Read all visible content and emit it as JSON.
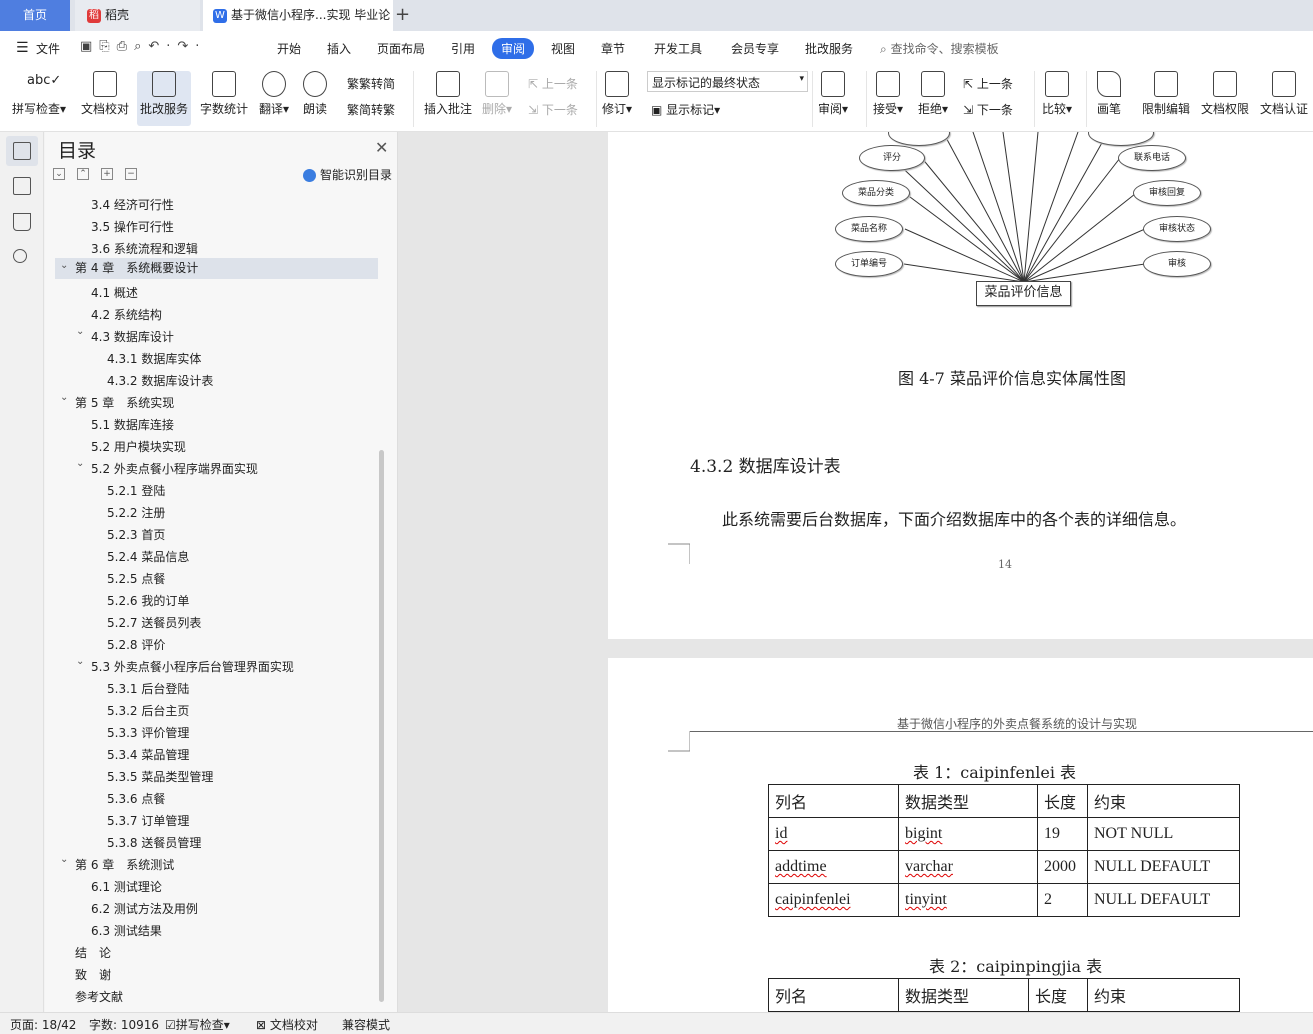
{
  "tabs": {
    "home": "首页",
    "daoke": "稻壳",
    "doc": "基于微信小程序...实现 毕业论"
  },
  "menu": [
    "文件",
    "开始",
    "插入",
    "页面布局",
    "引用",
    "审阅",
    "视图",
    "章节",
    "开发工具",
    "会员专享",
    "批改服务"
  ],
  "search": "查找命令、搜索模板",
  "ribbon": {
    "spell": "拼写检查",
    "proof": "文档校对",
    "correct": "批改服务",
    "count": "字数统计",
    "translate": "翻译",
    "read": "朗读",
    "to_trad": "繁转简",
    "to_simp": "简转繁",
    "insert_comment": "插入批注",
    "delete": "删除",
    "prev": "上一条",
    "next": "下一条",
    "revise": "修订",
    "markup_state": "显示标记的最终状态",
    "show_markup": "显示标记",
    "review": "审阅",
    "accept": "接受",
    "reject": "拒绝",
    "prev2": "上一条",
    "next2": "下一条",
    "compare": "比较",
    "pen": "画笔",
    "restrict": "限制编辑",
    "rights": "文档权限",
    "certify": "文档认证"
  },
  "nav": {
    "title": "目录",
    "smart": "智能识别目录",
    "items": [
      "3.4 经济可行性",
      "3.5 操作可行性",
      "3.6 系统流程和逻辑",
      "第 4 章　系统概要设计",
      "4.1  概述",
      "4.2  系统结构",
      "4.3  数据库设计",
      "4.3.1  数据库实体",
      "4.3.2  数据库设计表",
      "第 5 章　系统实现",
      "5.1 数据库连接",
      "5.2 用户模块实现",
      "5.2 外卖点餐小程序端界面实现",
      "5.2.1  登陆",
      "5.2.2 注册",
      "5.2.3 首页",
      "5.2.4 菜品信息",
      "5.2.5 点餐",
      "5.2.6 我的订单",
      "5.2.7 送餐员列表",
      "5.2.8 评价",
      "5.3  外卖点餐小程序后台管理界面实现",
      "5.3.1  后台登陆",
      "5.3.2  后台主页",
      "5.3.3 评价管理",
      "5.3.4 菜品管理",
      "5.3.5 菜品类型管理",
      "5.3.6 点餐",
      "5.3.7 订单管理",
      "5.3.8 送餐员管理",
      "第 6 章　系统测试",
      "6.1  测试理论",
      "6.2  测试方法及用例",
      "6.3 测试结果",
      "结　论",
      "致　谢",
      "参考文献"
    ]
  },
  "diagram": {
    "entity": "菜品评价信息",
    "left": [
      "评分",
      "菜品分类",
      "菜品名称",
      "订单编号"
    ],
    "right": [
      "联系电话",
      "审核回复",
      "审核状态",
      "审核"
    ]
  },
  "page1": {
    "caption": "图 4-7 菜品评价信息实体属性图",
    "heading": "4.3.2  数据库设计表",
    "body": "此系统需要后台数据库，下面介绍数据库中的各个表的详细信息。",
    "pagenum": "14"
  },
  "page2": {
    "header": "基于微信小程序的外卖点餐系统的设计与实现",
    "t1_title": "表 1：caipinfenlei 表",
    "t2_title": "表 2：caipinpingjia 表",
    "t1": [
      [
        "列名",
        "数据类型",
        "长度",
        "约束"
      ],
      [
        "id",
        "bigint",
        "19",
        "NOT NULL"
      ],
      [
        "addtime",
        "varchar",
        "2000",
        "  NULL DEFAULT"
      ],
      [
        "caipinfenlei",
        "tinyint",
        "2",
        "  NULL DEFAULT"
      ]
    ],
    "t2": [
      [
        "列名",
        "数据类型",
        "长度",
        "约束"
      ]
    ]
  },
  "status": {
    "page": "页面: 18/42",
    "words": "字数: 10916",
    "spell": "拼写检查",
    "proof": "文档校对",
    "compat": "兼容模式"
  }
}
